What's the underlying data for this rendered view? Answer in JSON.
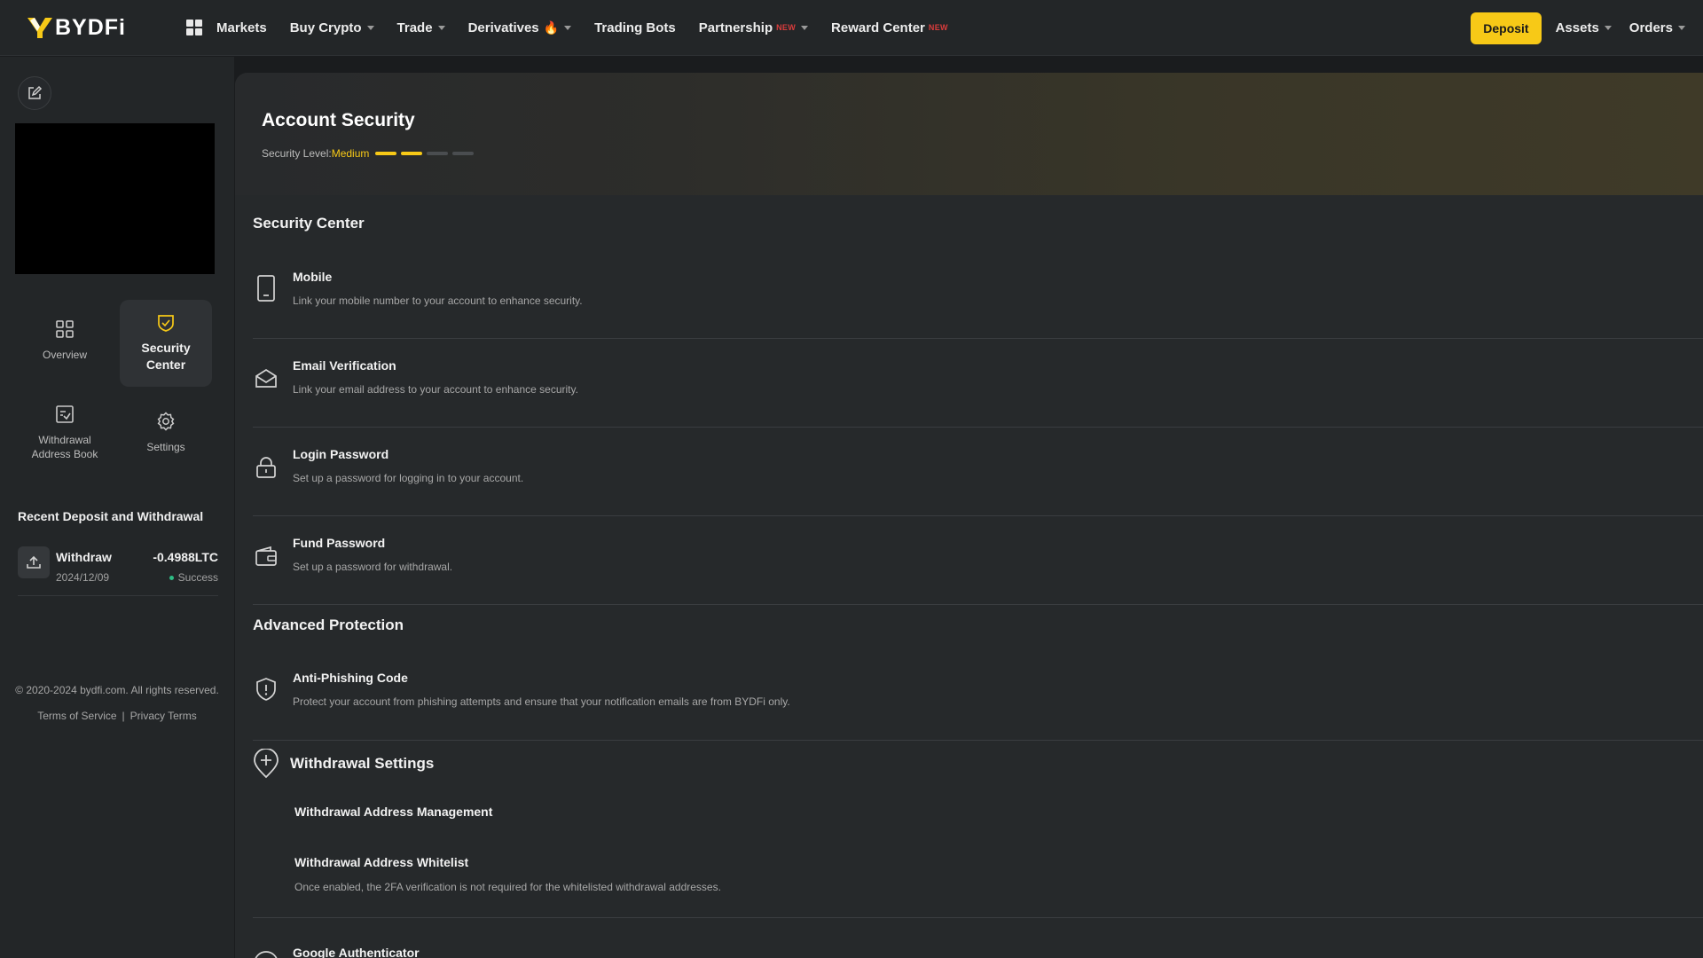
{
  "brand": {
    "name": "BYDFi"
  },
  "nav": {
    "items": [
      {
        "label": "Markets",
        "caret": false
      },
      {
        "label": "Buy Crypto",
        "caret": true
      },
      {
        "label": "Trade",
        "caret": true
      },
      {
        "label": "Derivatives",
        "caret": true,
        "fire": true
      },
      {
        "label": "Trading Bots",
        "caret": false
      },
      {
        "label": "Partnership",
        "caret": true,
        "badge": "NEW"
      },
      {
        "label": "Reward Center",
        "caret": false,
        "badge": "NEW"
      }
    ],
    "deposit": "Deposit",
    "assets": "Assets",
    "orders": "Orders"
  },
  "sidebar": {
    "menu": {
      "overview": "Overview",
      "security": "Security Center",
      "address_book": "Withdrawal Address Book",
      "settings": "Settings"
    },
    "recent_title": "Recent Deposit and Withdrawal",
    "recent": {
      "type": "Withdraw",
      "date": "2024/12/09",
      "amount": "-0.4988LTC",
      "status": "Success"
    },
    "copyright": "© 2020-2024 bydfi.com. All rights reserved.",
    "terms": "Terms of Service",
    "separator": "|",
    "privacy": "Privacy Terms"
  },
  "main": {
    "title": "Account Security",
    "security_level_label": "Security Level:",
    "security_level_value": "Medium",
    "security_level_bars": {
      "filled": 2,
      "total": 4
    },
    "security_center": {
      "title": "Security Center",
      "items": [
        {
          "title": "Mobile",
          "desc": "Link your mobile number to your account to enhance security."
        },
        {
          "title": "Email Verification",
          "desc": "Link your email address to your account to enhance security."
        },
        {
          "title": "Login Password",
          "desc": "Set up a password for logging in to your account."
        },
        {
          "title": "Fund Password",
          "desc": "Set up a password for withdrawal."
        }
      ]
    },
    "advanced": {
      "title": "Advanced Protection",
      "anti_phishing": {
        "title": "Anti-Phishing Code",
        "desc": "Protect your account from phishing attempts and ensure that your notification emails are from BYDFi only."
      }
    },
    "withdrawal_settings": {
      "title": "Withdrawal Settings",
      "management": "Withdrawal Address Management",
      "whitelist": {
        "title": "Withdrawal Address Whitelist",
        "desc": "Once enabled, the 2FA verification is not required for the whitelisted withdrawal addresses."
      }
    },
    "google_auth": {
      "title": "Google Authenticator"
    }
  },
  "colors": {
    "accent": "#f7c917",
    "success": "#2ebd85",
    "new_badge": "#d93c3c"
  }
}
